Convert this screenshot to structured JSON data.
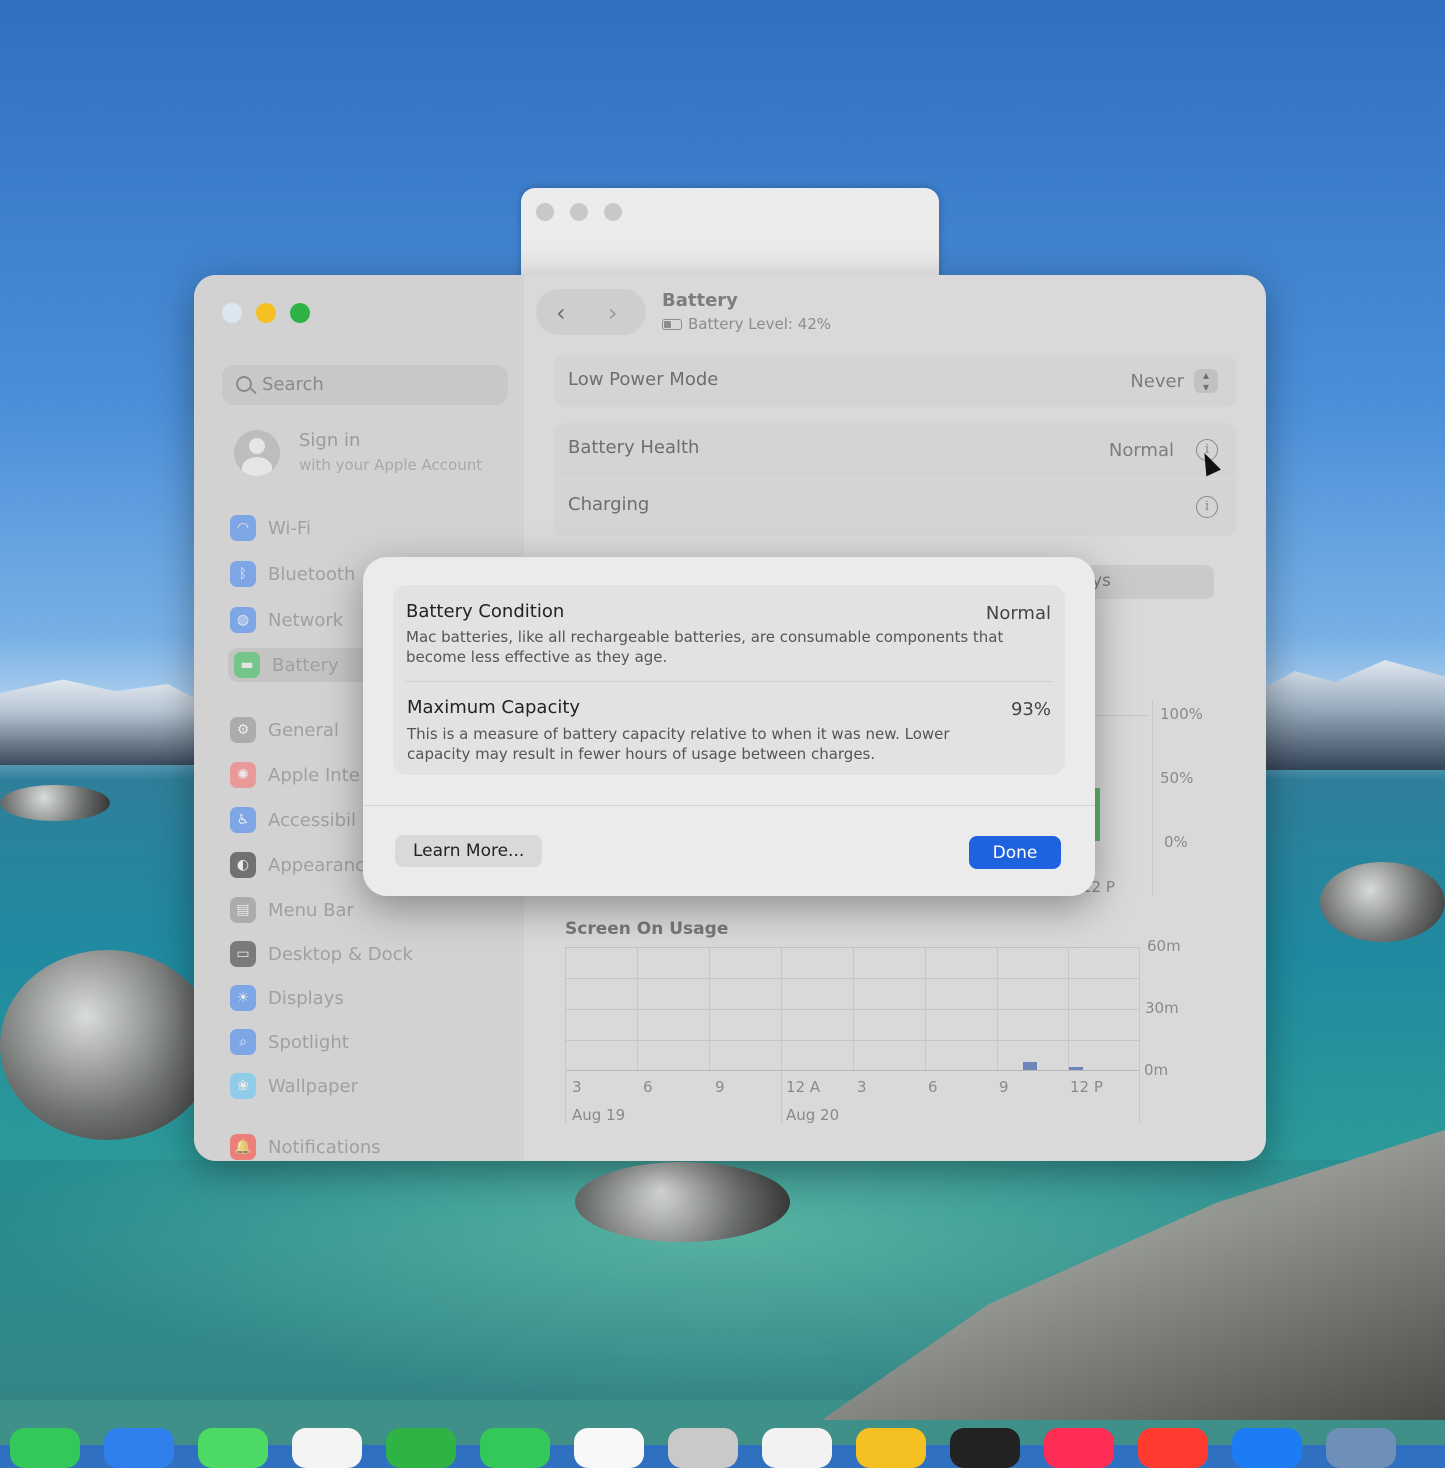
{
  "window": {
    "title": "Battery",
    "subtitle": "Battery Level: 42%"
  },
  "sidebar": {
    "search_placeholder": "Search",
    "account_title": "Sign in",
    "account_sub": "with your Apple Account",
    "items": [
      {
        "label": "Wi-Fi",
        "icon": "wifi-icon",
        "color": "#3b82f6"
      },
      {
        "label": "Bluetooth",
        "icon": "bluetooth-icon",
        "color": "#3b82f6"
      },
      {
        "label": "Network",
        "icon": "globe-icon",
        "color": "#3b82f6"
      },
      {
        "label": "Battery",
        "icon": "battery-icon",
        "color": "#34c759"
      },
      {
        "label": "General",
        "icon": "gear-icon",
        "color": "#8e8e93"
      },
      {
        "label": "Apple Inte",
        "icon": "apple-intelligence-icon",
        "color": "#ff6b6b"
      },
      {
        "label": "Accessibil",
        "icon": "accessibility-icon",
        "color": "#3b82f6"
      },
      {
        "label": "Appearanc",
        "icon": "appearance-icon",
        "color": "#222222"
      },
      {
        "label": "Menu Bar",
        "icon": "menu-bar-icon",
        "color": "#8e8e93"
      },
      {
        "label": "Desktop & Dock",
        "icon": "dock-icon",
        "color": "#333333"
      },
      {
        "label": "Displays",
        "icon": "sun-icon",
        "color": "#3b82f6"
      },
      {
        "label": "Spotlight",
        "icon": "magnifier-icon",
        "color": "#3b82f6"
      },
      {
        "label": "Wallpaper",
        "icon": "flower-icon",
        "color": "#5ac8fa"
      },
      {
        "label": "Notifications",
        "icon": "bell-icon",
        "color": "#ff3b30"
      }
    ]
  },
  "settings": {
    "low_power_label": "Low Power Mode",
    "low_power_value": "Never",
    "health_label": "Battery Health",
    "health_value": "Normal",
    "charging_label": "Charging",
    "obscured_tab_fragment": "ys"
  },
  "battery_chart": {
    "y_labels": [
      "100%",
      "50%",
      "0%"
    ],
    "x_label_visible": "12 P"
  },
  "screen_usage": {
    "title": "Screen On Usage",
    "y_labels": [
      "60m",
      "30m",
      "0m"
    ],
    "x_labels": [
      "3",
      "6",
      "9",
      "12 A",
      "3",
      "6",
      "9",
      "12 P"
    ],
    "date_labels": [
      "Aug 19",
      "Aug 20"
    ]
  },
  "dialog": {
    "condition_title": "Battery Condition",
    "condition_value": "Normal",
    "condition_desc": "Mac batteries, like all rechargeable batteries, are consumable components that become less effective as they age.",
    "capacity_title": "Maximum Capacity",
    "capacity_value": "93%",
    "capacity_desc": "This is a measure of battery capacity relative to when it was new. Lower capacity may result in fewer hours of usage between charges.",
    "learn_more": "Learn More...",
    "done": "Done"
  },
  "colors": {
    "accent": "#1f62e0",
    "traffic_close": "#dce7ef",
    "traffic_min": "#f5c021",
    "traffic_max": "#2fb344"
  }
}
